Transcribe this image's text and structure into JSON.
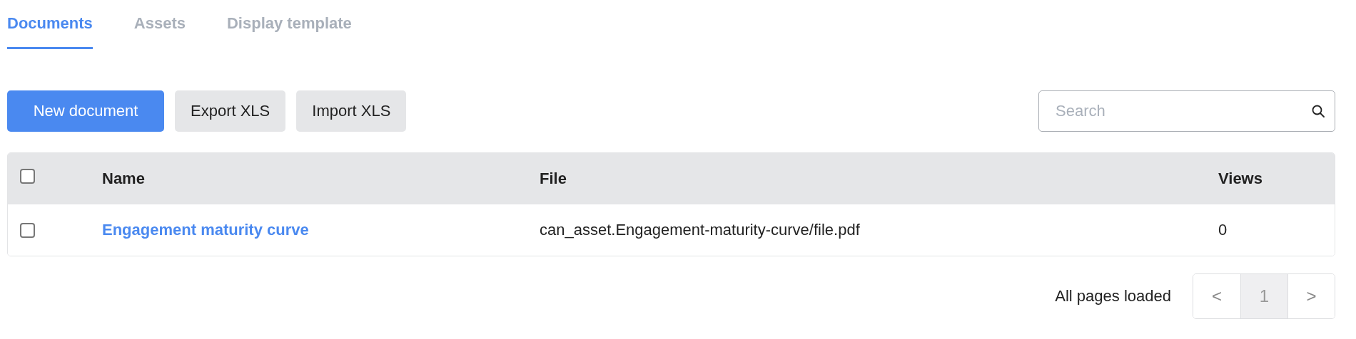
{
  "tabs": [
    {
      "label": "Documents",
      "selected": true
    },
    {
      "label": "Assets",
      "selected": false
    },
    {
      "label": "Display template",
      "selected": false
    }
  ],
  "toolbar": {
    "buttons": [
      {
        "label": "New document",
        "kind": "primary"
      },
      {
        "label": "Export XLS",
        "kind": "secondary"
      },
      {
        "label": "Import XLS",
        "kind": "secondary"
      }
    ],
    "search": {
      "placeholder": "Search"
    }
  },
  "table": {
    "select_all": {
      "checked": false
    },
    "columns": [
      "Name",
      "File",
      "Views"
    ],
    "rows": [
      {
        "checked": false,
        "name": "Engagement maturity curve",
        "file": "can_asset.Engagement-maturity-curve/file.pdf",
        "views": "0"
      }
    ]
  },
  "pagination": {
    "status": "All pages loaded",
    "prev": "<",
    "pages": [
      {
        "label": "1",
        "selected": true
      }
    ],
    "next": ">"
  }
}
